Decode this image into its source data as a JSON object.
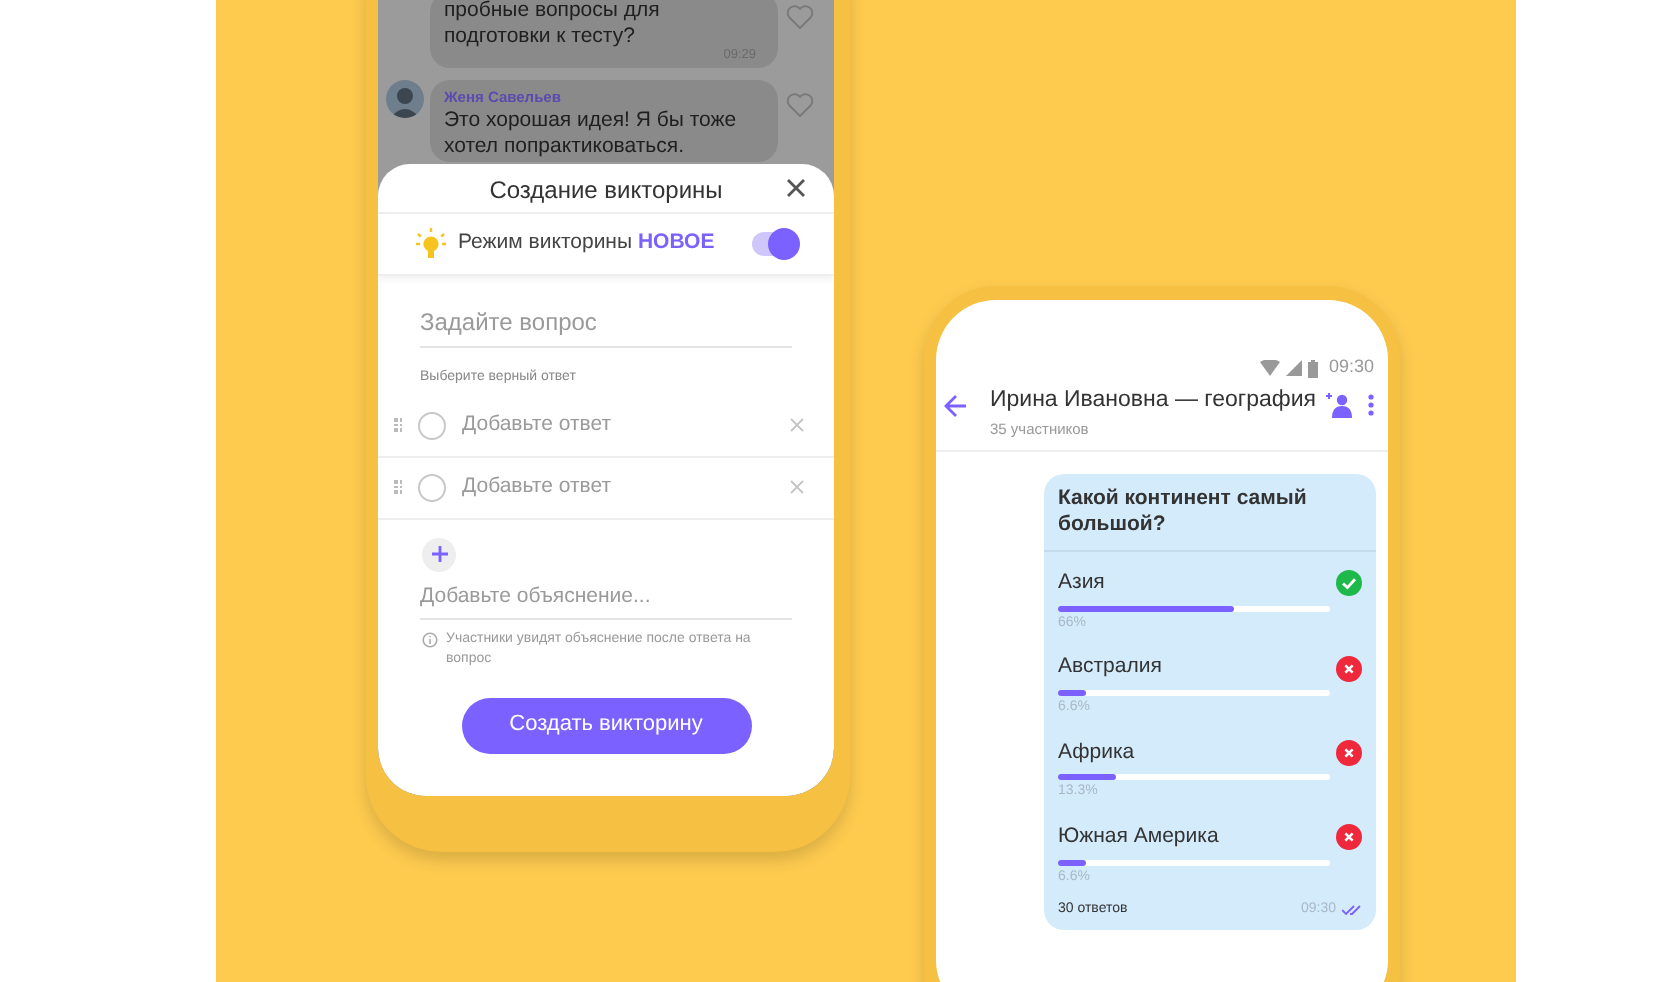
{
  "left_phone": {
    "chat": [
      {
        "text": "пробные вопросы для\nподготовки к тесту?",
        "time": "09:29"
      },
      {
        "sender": "Женя Савельев",
        "text": "Это хорошая идея! Я бы тоже\nхотел попрактиковаться."
      }
    ],
    "quiz_sheet": {
      "title": "Создание викторины",
      "mode": {
        "label": "Режим викторины **НОВОЕ**",
        "on": true
      },
      "question": {
        "placeholder": "Задайте вопрос"
      },
      "answers_hint": "Выберите верный ответ",
      "answers": [
        {
          "placeholder": "Добавьте ответ",
          "checked": false
        },
        {
          "placeholder": "Добавьте ответ",
          "checked": false
        }
      ],
      "explanation": {
        "placeholder": "Добавьте объяснение..."
      },
      "note": "Участники увидят объяснение после ответа на вопрос",
      "button": "Создать викторину"
    }
  },
  "right_phone": {
    "status_time": "09:30",
    "header": {
      "title": "Ирина Ивановна — география",
      "subtitle": "35 участников"
    },
    "quiz": {
      "question": "Какой континент самый большой?",
      "options": [
        {
          "label": "Азия",
          "level": 0.65,
          "percent": "66%",
          "correct": true
        },
        {
          "label": "Австралия",
          "level": 0.1,
          "percent": "6.6%",
          "correct": false
        },
        {
          "label": "Африка",
          "level": 0.21,
          "percent": "13.3%",
          "correct": false
        },
        {
          "label": "Южная Америка",
          "level": 0.1,
          "percent": "6.6%",
          "correct": false
        }
      ],
      "answers_count": "30 ответов",
      "time": "09:30"
    }
  }
}
